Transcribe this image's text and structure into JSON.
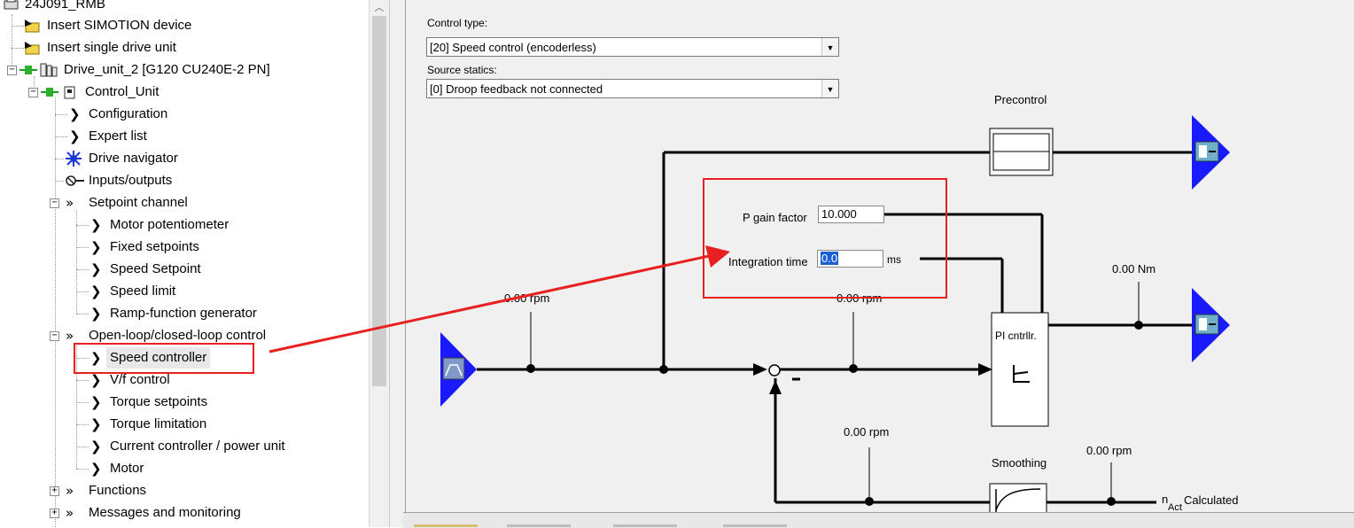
{
  "tree": {
    "root_label": "24J091_RMB",
    "items": [
      {
        "label": "Insert SIMOTION device",
        "icon": "insert-device-icon"
      },
      {
        "label": "Insert single drive unit",
        "icon": "insert-drive-icon"
      },
      {
        "label": "Drive_unit_2 [G120 CU240E-2 PN]",
        "icon": "drive-unit-icon"
      },
      {
        "label": "Control_Unit",
        "icon": "control-unit-icon"
      },
      {
        "label": "Configuration",
        "icon": "chevron-right-icon"
      },
      {
        "label": "Expert list",
        "icon": "chevron-right-icon"
      },
      {
        "label": "Drive navigator",
        "icon": "navigator-icon"
      },
      {
        "label": "Inputs/outputs",
        "icon": "io-icon"
      },
      {
        "label": "Setpoint channel",
        "icon": "double-chevron-icon"
      },
      {
        "label": "Motor potentiometer",
        "icon": "chevron-right-icon"
      },
      {
        "label": "Fixed setpoints",
        "icon": "chevron-right-icon"
      },
      {
        "label": "Speed Setpoint",
        "icon": "chevron-right-icon"
      },
      {
        "label": "Speed limit",
        "icon": "chevron-right-icon"
      },
      {
        "label": "Ramp-function generator",
        "icon": "chevron-right-icon"
      },
      {
        "label": "Open-loop/closed-loop control",
        "icon": "double-chevron-icon"
      },
      {
        "label": "Speed controller",
        "icon": "chevron-right-icon"
      },
      {
        "label": "V/f control",
        "icon": "chevron-right-icon"
      },
      {
        "label": "Torque setpoints",
        "icon": "chevron-right-icon"
      },
      {
        "label": "Torque limitation",
        "icon": "chevron-right-icon"
      },
      {
        "label": "Current controller / power unit",
        "icon": "chevron-right-icon"
      },
      {
        "label": "Motor",
        "icon": "chevron-right-icon"
      },
      {
        "label": "Functions",
        "icon": "double-chevron-icon"
      },
      {
        "label": "Messages and monitoring",
        "icon": "double-chevron-icon"
      }
    ]
  },
  "form": {
    "control_type_label": "Control type:",
    "control_type_value": "[20] Speed control (encoderless)",
    "source_statics_label": "Source statics:",
    "source_statics_value": "[0] Droop feedback not connected"
  },
  "diagram": {
    "precontrol_label": "Precontrol",
    "p_gain_label": "P gain factor",
    "p_gain_value": "10.000",
    "integration_time_label": "Integration time",
    "integration_time_value": "0.0",
    "integration_time_unit": "ms",
    "speed_after_ramp": "0.00 rpm",
    "speed_setpoint_sum": "0.00 rpm",
    "torque_output": "0.00 Nm",
    "actual_speed_left": "0.00 rpm",
    "actual_speed_right": "0.00 rpm",
    "pi_controller_label": "PI cntrllr.",
    "smoothing_label": "Smoothing",
    "n_act_symbol": "n",
    "n_act_subscript": "Act",
    "n_act_suffix": "Calculated",
    "minus_sign": "-"
  },
  "colors": {
    "accent_blue": "#1a1aff",
    "annotation_red": "#e82020",
    "selection_bg": "#e8e8e8"
  }
}
